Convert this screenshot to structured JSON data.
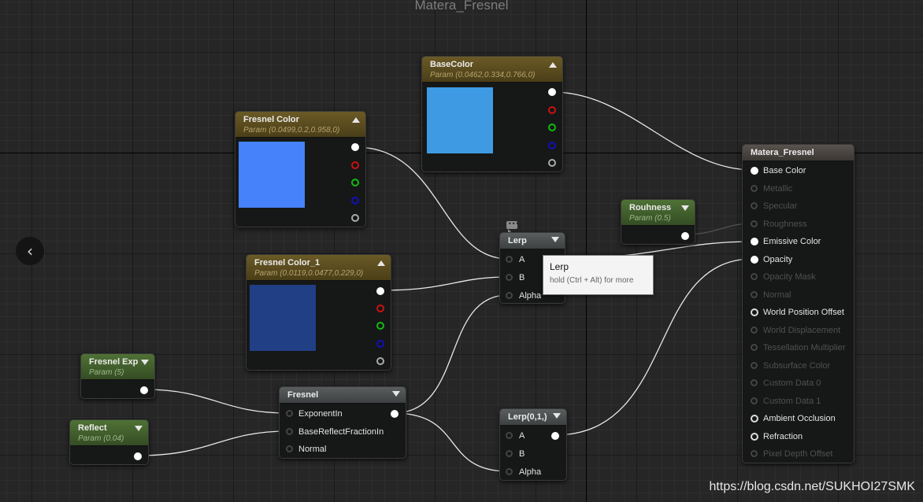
{
  "graph_title": "Matera_Fresnel",
  "watermark": "https://blog.csdn.net/SUKHOI27SMK",
  "tooltip": {
    "title": "Lerp",
    "hint": "hold (Ctrl + Alt) for more"
  },
  "nodes": {
    "basecolor": {
      "title": "BaseColor",
      "subtitle": "Param (0.0462,0.334,0.766,0)",
      "swatch_color": "#3e9be3"
    },
    "fresnel_color": {
      "title": "Fresnel Color",
      "subtitle": "Param (0.0499,0.2,0.958,0)",
      "swatch_color": "#4682fa"
    },
    "fresnel_color_1": {
      "title": "Fresnel Color_1",
      "subtitle": "Param (0.0119,0.0477,0.229,0)",
      "swatch_color": "#213f84"
    },
    "rouhness": {
      "title": "Rouhness",
      "subtitle": "Param (0.5)"
    },
    "fresnel_exp": {
      "title": "Fresnel Exp",
      "subtitle": "Param (5)"
    },
    "reflect": {
      "title": "Reflect",
      "subtitle": "Param (0.04)"
    },
    "fresnel": {
      "title": "Fresnel",
      "inputs": [
        "ExponentIn",
        "BaseReflectFractionIn",
        "Normal"
      ]
    },
    "lerp": {
      "title": "Lerp",
      "inputs": [
        "A",
        "B",
        "Alpha"
      ]
    },
    "lerp01": {
      "title": "Lerp(0,1,)",
      "inputs": [
        "A",
        "B",
        "Alpha"
      ]
    },
    "material": {
      "title": "Matera_Fresnel",
      "inputs": [
        {
          "label": "Base Color",
          "active": true
        },
        {
          "label": "Metallic",
          "active": false
        },
        {
          "label": "Specular",
          "active": false
        },
        {
          "label": "Roughness",
          "active": false
        },
        {
          "label": "Emissive Color",
          "active": true
        },
        {
          "label": "Opacity",
          "active": true
        },
        {
          "label": "Opacity Mask",
          "active": false
        },
        {
          "label": "Normal",
          "active": false
        },
        {
          "label": "World Position Offset",
          "active": true
        },
        {
          "label": "World Displacement",
          "active": false
        },
        {
          "label": "Tessellation Multiplier",
          "active": false
        },
        {
          "label": "Subsurface Color",
          "active": false
        },
        {
          "label": "Custom Data 0",
          "active": false
        },
        {
          "label": "Custom Data 1",
          "active": false
        },
        {
          "label": "Ambient Occlusion",
          "active": true
        },
        {
          "label": "Refraction",
          "active": true
        },
        {
          "label": "Pixel Depth Offset",
          "active": false
        }
      ]
    }
  },
  "colors": {
    "canvas": "#262626",
    "parameter_header": "#6b5a26",
    "scalar_header": "#4f7236",
    "channel_red": "#cc1111",
    "channel_green": "#11bb11",
    "channel_blue": "#1111bb"
  }
}
